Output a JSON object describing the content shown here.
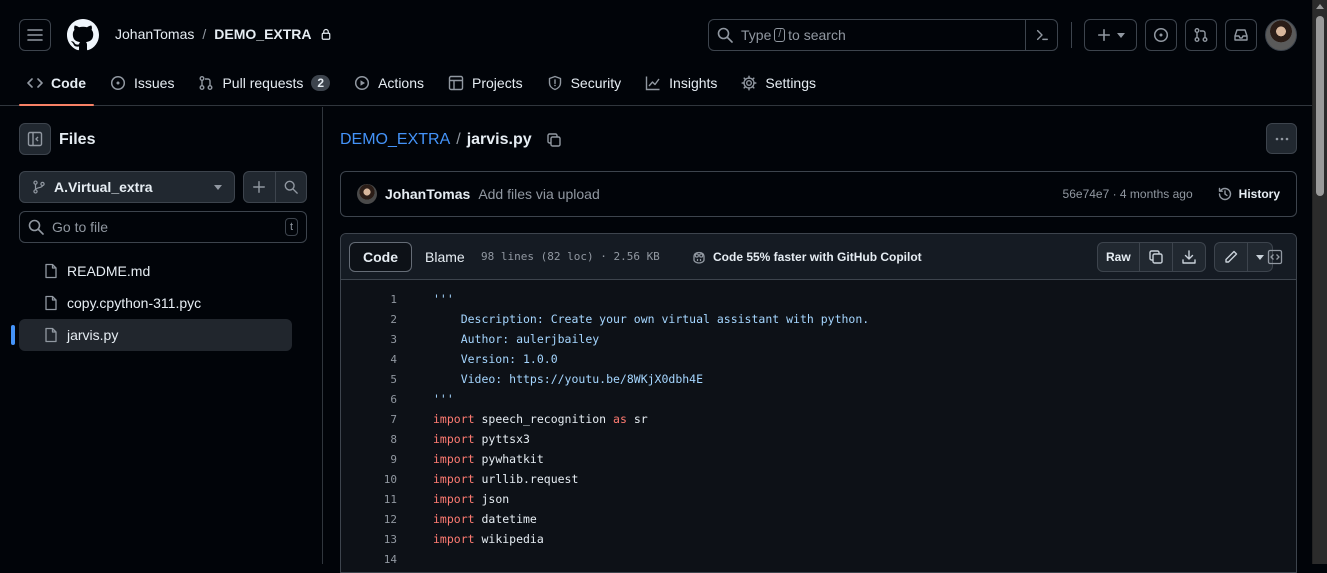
{
  "header": {
    "owner": "JohanTomas",
    "separator": "/",
    "repo": "DEMO_EXTRA",
    "search_prefix": "Type",
    "search_key": "/",
    "search_suffix": "to search"
  },
  "nav": [
    {
      "label": "Code",
      "icon": "code-icon",
      "active": true
    },
    {
      "label": "Issues",
      "icon": "issue-icon"
    },
    {
      "label": "Pull requests",
      "icon": "pull-request-icon",
      "count": "2"
    },
    {
      "label": "Actions",
      "icon": "play-icon"
    },
    {
      "label": "Projects",
      "icon": "table-icon"
    },
    {
      "label": "Security",
      "icon": "shield-icon"
    },
    {
      "label": "Insights",
      "icon": "graph-icon"
    },
    {
      "label": "Settings",
      "icon": "gear-icon"
    }
  ],
  "sidebar": {
    "title": "Files",
    "branch": "A.Virtual_extra",
    "goto_placeholder": "Go to file",
    "goto_key": "t",
    "files": [
      {
        "name": "README.md"
      },
      {
        "name": "copy.cpython-311.pyc"
      },
      {
        "name": "jarvis.py",
        "selected": true
      }
    ]
  },
  "main": {
    "crumb_repo": "DEMO_EXTRA",
    "crumb_sep": "/",
    "crumb_file": "jarvis.py",
    "commit": {
      "author": "JohanTomas",
      "message": "Add files via upload",
      "meta": "56e74e7 · 4 months ago",
      "history": "History"
    },
    "file": {
      "tab_code": "Code",
      "tab_blame": "Blame",
      "info": "98 lines (82 loc) · 2.56 KB",
      "copilot": "Code 55% faster with GitHub Copilot",
      "raw": "Raw"
    },
    "code_lines": [
      {
        "n": "1",
        "parts": [
          {
            "t": "'''",
            "c": "str"
          }
        ]
      },
      {
        "n": "2",
        "parts": [
          {
            "t": "    Description: Create your own virtual assistant with python.",
            "c": "str"
          }
        ]
      },
      {
        "n": "3",
        "parts": [
          {
            "t": "    Author: aulerjbailey",
            "c": "str"
          }
        ]
      },
      {
        "n": "4",
        "parts": [
          {
            "t": "    Version: 1.0.0",
            "c": "str"
          }
        ]
      },
      {
        "n": "5",
        "parts": [
          {
            "t": "    Video: https://youtu.be/8WKjX0dbh4E",
            "c": "str"
          }
        ]
      },
      {
        "n": "6",
        "parts": [
          {
            "t": "'''",
            "c": "str"
          }
        ]
      },
      {
        "n": "7",
        "parts": [
          {
            "t": "import",
            "c": "kw"
          },
          {
            "t": " speech_recognition ",
            "c": ""
          },
          {
            "t": "as",
            "c": "kw"
          },
          {
            "t": " sr",
            "c": ""
          }
        ]
      },
      {
        "n": "8",
        "parts": [
          {
            "t": "import",
            "c": "kw"
          },
          {
            "t": " pyttsx3",
            "c": ""
          }
        ]
      },
      {
        "n": "9",
        "parts": [
          {
            "t": "import",
            "c": "kw"
          },
          {
            "t": " pywhatkit",
            "c": ""
          }
        ]
      },
      {
        "n": "10",
        "parts": [
          {
            "t": "import",
            "c": "kw"
          },
          {
            "t": " urllib.request",
            "c": ""
          }
        ]
      },
      {
        "n": "11",
        "parts": [
          {
            "t": "import",
            "c": "kw"
          },
          {
            "t": " json",
            "c": ""
          }
        ]
      },
      {
        "n": "12",
        "parts": [
          {
            "t": "import",
            "c": "kw"
          },
          {
            "t": " datetime",
            "c": ""
          }
        ]
      },
      {
        "n": "13",
        "parts": [
          {
            "t": "import",
            "c": "kw"
          },
          {
            "t": " wikipedia",
            "c": ""
          }
        ]
      },
      {
        "n": "14",
        "parts": []
      }
    ]
  }
}
